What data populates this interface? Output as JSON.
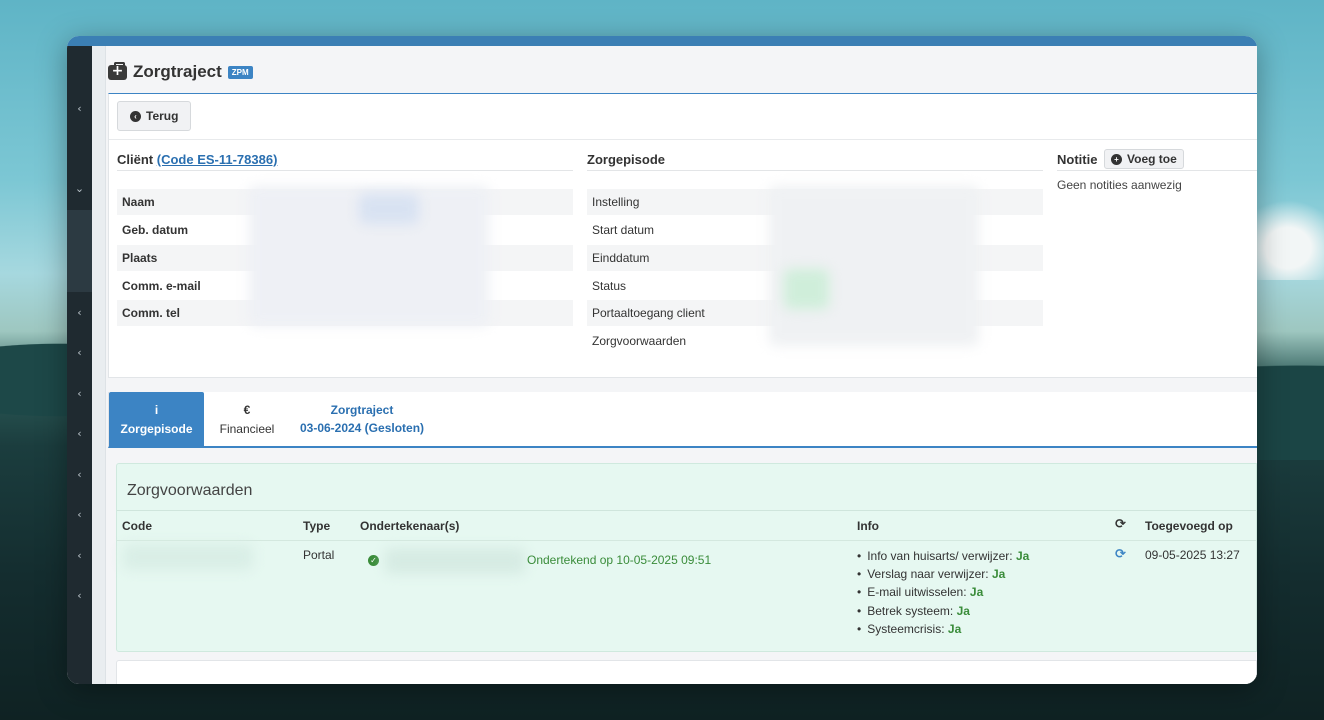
{
  "page": {
    "title": "Zorgtraject",
    "badge": "ZPM",
    "back_button": "Terug"
  },
  "client": {
    "heading": "Cliënt",
    "code_link": "(Code ES-11-78386)",
    "rows": [
      {
        "label": "Naam"
      },
      {
        "label": "Geb. datum"
      },
      {
        "label": "Plaats"
      },
      {
        "label": "Comm. e-mail"
      },
      {
        "label": "Comm. tel"
      }
    ]
  },
  "episode": {
    "heading": "Zorgepisode",
    "rows": [
      {
        "label": "Instelling"
      },
      {
        "label": "Start datum"
      },
      {
        "label": "Einddatum"
      },
      {
        "label": "Status"
      },
      {
        "label": "Portaaltoegang client"
      },
      {
        "label": "Zorgvoorwaarden"
      }
    ]
  },
  "notes": {
    "heading": "Notitie",
    "add_button": "Voeg toe",
    "empty_text": "Geen notities aanwezig"
  },
  "tabs": {
    "episode": {
      "icon": "i",
      "label": "Zorgepisode"
    },
    "finance": {
      "icon": "€",
      "label": "Financieel"
    },
    "trajectory": {
      "line1": "Zorgtraject",
      "line2": "03-06-2024 (Gesloten)"
    }
  },
  "conditions": {
    "title": "Zorgvoorwaarden",
    "headers": {
      "code": "Code",
      "type": "Type",
      "signers": "Ondertekenaar(s)",
      "info": "Info",
      "added": "Toegevoegd op"
    },
    "row": {
      "type": "Portal",
      "signed": "Ondertekend op 10-05-2025 09:51",
      "added": "09-05-2025 13:27",
      "info": [
        {
          "label": "Info van huisarts/ verwijzer:",
          "value": "Ja"
        },
        {
          "label": "Verslag naar verwijzer:",
          "value": "Ja"
        },
        {
          "label": "E-mail uitwisselen:",
          "value": "Ja"
        },
        {
          "label": "Betrek systeem:",
          "value": "Ja"
        },
        {
          "label": "Systeemcrisis:",
          "value": "Ja"
        }
      ]
    }
  },
  "colors": {
    "accent": "#3c84c4",
    "success": "#3a8c3a",
    "panel_green": "#e6f8f1"
  }
}
